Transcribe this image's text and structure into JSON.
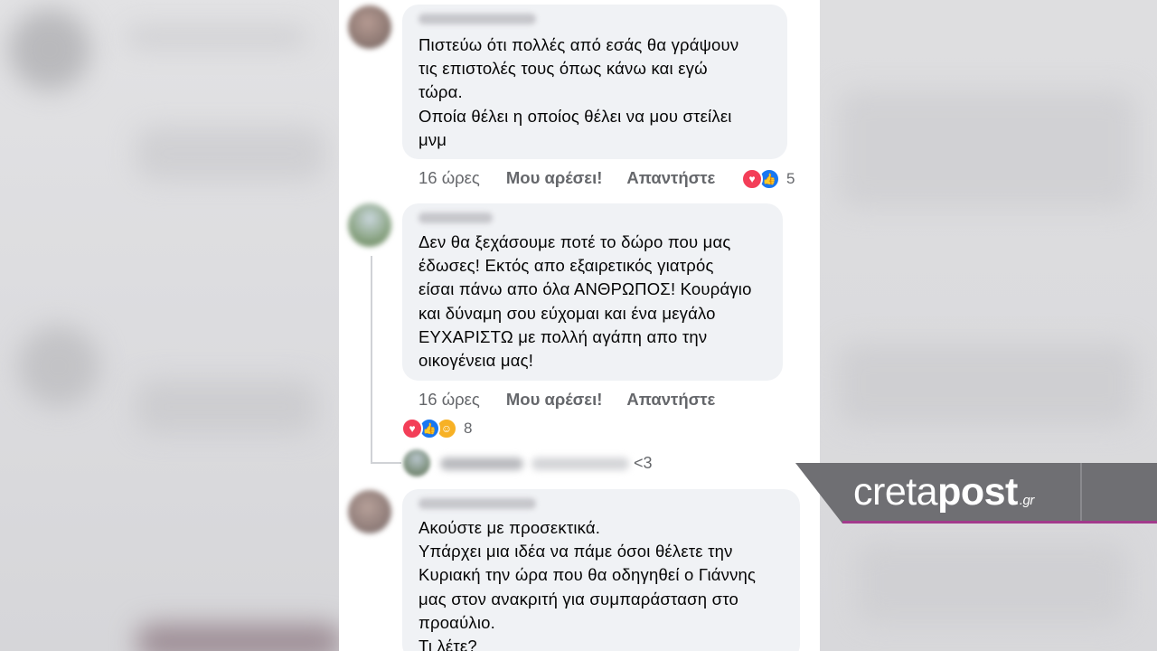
{
  "comments": [
    {
      "text_lines": [
        "Πιστεύω ότι πολλές από εσάς θα γράψουν",
        "τις επιστολές τους όπως κάνω και εγώ",
        "τώρα.",
        "Οποία θέλει η οποίος θέλει να μου στείλει",
        "μνμ"
      ],
      "time": "16 ώρες",
      "like_label": "Μου αρέσει!",
      "reply_label": "Απαντήστε",
      "reaction_count": "5"
    },
    {
      "text_lines": [
        "Δεν θα ξεχάσουμε ποτέ το δώρο που μας",
        "έδωσες! Εκτός απο εξαιρετικός γιατρός",
        "είσαι πάνω απο όλα ΑΝΘΡΩΠΟΣ! Κουράγιο",
        "και δύναμη σου εύχομαι και ένα μεγάλο",
        "ΕΥΧΑΡΙΣΤΩ με πολλή αγάπη απο την",
        "οικογένεια μας!"
      ],
      "time": "16 ώρες",
      "like_label": "Μου αρέσει!",
      "reply_label": "Απαντήστε",
      "reaction_count": "8",
      "reply_preview": "<3"
    },
    {
      "text_lines": [
        "Ακούστε με προσεκτικά.",
        "Υπάρχει μια ιδέα να πάμε όσοι θέλετε την",
        "Κυριακή την ώρα που θα οδηγηθεί ο Γιάννης",
        "μας στον ανακριτή για συμπαράσταση στο",
        "προαύλιο.",
        "Τι λέτε?"
      ]
    }
  ],
  "watermark": {
    "part_light": "creta",
    "part_bold": "post",
    "suffix": ".gr",
    "accent_color": "#a23a8c",
    "band_color": "#6f6f73"
  },
  "reaction_icons": [
    "love-icon",
    "like-icon",
    "care-icon"
  ]
}
